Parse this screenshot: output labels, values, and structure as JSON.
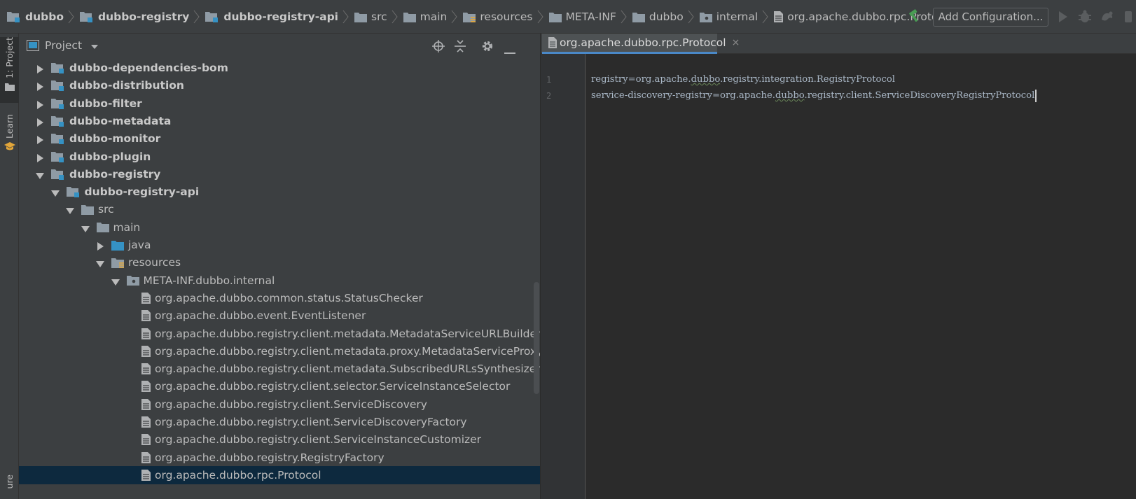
{
  "navbar": {
    "breadcrumbs": [
      {
        "label": "dubbo",
        "icon": "module-folder-icon",
        "bold": true
      },
      {
        "label": "dubbo-registry",
        "icon": "module-folder-icon",
        "bold": true
      },
      {
        "label": "dubbo-registry-api",
        "icon": "module-folder-icon",
        "bold": true
      },
      {
        "label": "src",
        "icon": "folder-icon",
        "bold": false
      },
      {
        "label": "main",
        "icon": "folder-icon",
        "bold": false
      },
      {
        "label": "resources",
        "icon": "resources-folder-icon",
        "bold": false
      },
      {
        "label": "META-INF",
        "icon": "folder-icon",
        "bold": false
      },
      {
        "label": "dubbo",
        "icon": "folder-icon",
        "bold": false
      },
      {
        "label": "internal",
        "icon": "package-folder-icon",
        "bold": false
      },
      {
        "label": "org.apache.dubbo.rpc.Protocol",
        "icon": "text-file-icon",
        "bold": false
      }
    ],
    "add_configuration_label": "Add Configuration...",
    "toolbar_icons": [
      "hammer-icon",
      "run-icon",
      "debug-icon",
      "coverage-icon"
    ]
  },
  "toolstrip": {
    "project_tab": "1: Project",
    "learn_tab": "Learn",
    "structure_tab": "ure"
  },
  "project_panel": {
    "title": "Project",
    "header_icons": [
      "locate-icon",
      "collapse-all-icon",
      "gear-icon",
      "hide-icon"
    ],
    "tree": [
      {
        "label": "dubbo-dependencies-bom",
        "level": 0,
        "expanded": false,
        "icon": "module-folder-icon",
        "bold": true
      },
      {
        "label": "dubbo-distribution",
        "level": 0,
        "expanded": false,
        "icon": "module-folder-icon",
        "bold": true
      },
      {
        "label": "dubbo-filter",
        "level": 0,
        "expanded": false,
        "icon": "module-folder-icon",
        "bold": true
      },
      {
        "label": "dubbo-metadata",
        "level": 0,
        "expanded": false,
        "icon": "module-folder-icon",
        "bold": true
      },
      {
        "label": "dubbo-monitor",
        "level": 0,
        "expanded": false,
        "icon": "module-folder-icon",
        "bold": true
      },
      {
        "label": "dubbo-plugin",
        "level": 0,
        "expanded": false,
        "icon": "module-folder-icon",
        "bold": true
      },
      {
        "label": "dubbo-registry",
        "level": 0,
        "expanded": true,
        "icon": "module-folder-icon",
        "bold": true
      },
      {
        "label": "dubbo-registry-api",
        "level": 1,
        "expanded": true,
        "icon": "module-folder-icon",
        "bold": true
      },
      {
        "label": "src",
        "level": 2,
        "expanded": true,
        "icon": "folder-icon",
        "bold": false
      },
      {
        "label": "main",
        "level": 3,
        "expanded": true,
        "icon": "folder-icon",
        "bold": false
      },
      {
        "label": "java",
        "level": 4,
        "expanded": false,
        "icon": "source-folder-icon",
        "bold": false
      },
      {
        "label": "resources",
        "level": 4,
        "expanded": true,
        "icon": "resources-folder-icon",
        "bold": false
      },
      {
        "label": "META-INF.dubbo.internal",
        "level": 5,
        "expanded": true,
        "icon": "package-folder-icon",
        "bold": false
      },
      {
        "label": "org.apache.dubbo.common.status.StatusChecker",
        "level": 6,
        "leaf": true,
        "icon": "text-file-icon",
        "bold": false
      },
      {
        "label": "org.apache.dubbo.event.EventListener",
        "level": 6,
        "leaf": true,
        "icon": "text-file-icon",
        "bold": false
      },
      {
        "label": "org.apache.dubbo.registry.client.metadata.MetadataServiceURLBuilder",
        "level": 6,
        "leaf": true,
        "icon": "text-file-icon",
        "bold": false
      },
      {
        "label": "org.apache.dubbo.registry.client.metadata.proxy.MetadataServiceProxyFa",
        "level": 6,
        "leaf": true,
        "icon": "text-file-icon",
        "bold": false
      },
      {
        "label": "org.apache.dubbo.registry.client.metadata.SubscribedURLsSynthesizer",
        "level": 6,
        "leaf": true,
        "icon": "text-file-icon",
        "bold": false
      },
      {
        "label": "org.apache.dubbo.registry.client.selector.ServiceInstanceSelector",
        "level": 6,
        "leaf": true,
        "icon": "text-file-icon",
        "bold": false
      },
      {
        "label": "org.apache.dubbo.registry.client.ServiceDiscovery",
        "level": 6,
        "leaf": true,
        "icon": "text-file-icon",
        "bold": false
      },
      {
        "label": "org.apache.dubbo.registry.client.ServiceDiscoveryFactory",
        "level": 6,
        "leaf": true,
        "icon": "text-file-icon",
        "bold": false
      },
      {
        "label": "org.apache.dubbo.registry.client.ServiceInstanceCustomizer",
        "level": 6,
        "leaf": true,
        "icon": "text-file-icon",
        "bold": false
      },
      {
        "label": "org.apache.dubbo.registry.RegistryFactory",
        "level": 6,
        "leaf": true,
        "icon": "text-file-icon",
        "bold": false
      },
      {
        "label": "org.apache.dubbo.rpc.Protocol",
        "level": 6,
        "leaf": true,
        "icon": "text-file-icon",
        "bold": false,
        "selected": true
      }
    ]
  },
  "editor": {
    "tab_label": "org.apache.dubbo.rpc.Protocol",
    "tab_close": "×",
    "lines": [
      {
        "number": "1",
        "before": "registry=org.apache.",
        "marked": "dubbo",
        "after": ".registry.integration.RegistryProtocol"
      },
      {
        "number": "2",
        "before": "service-discovery-registry=org.apache.",
        "marked": "dubbo",
        "after": ".registry.client.ServiceDiscoveryRegistryProtocol"
      }
    ]
  },
  "colors": {
    "background": "#2b2b2b",
    "panel": "#3c3f41",
    "selection": "#0d293e",
    "tab_underline": "#4a88c7",
    "hammer": "#499c54",
    "folder": "#8f9ba5",
    "source_folder": "#3592c4"
  }
}
